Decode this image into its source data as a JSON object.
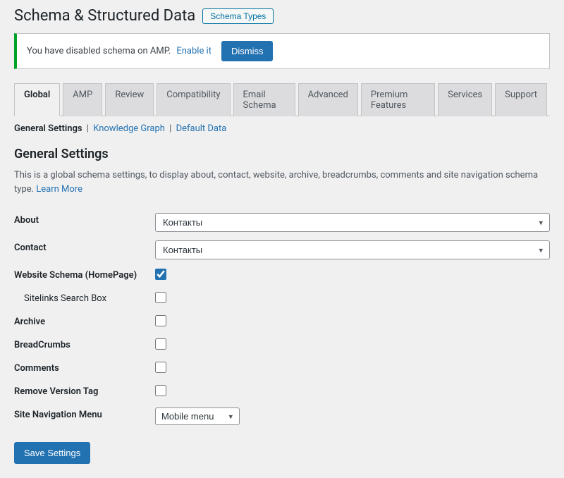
{
  "header": {
    "title": "Schema & Structured Data",
    "schema_types_btn": "Schema Types"
  },
  "notice": {
    "text": "You have disabled schema on AMP.",
    "enable_link": "Enable it",
    "dismiss": "Dismiss"
  },
  "tabs": [
    {
      "label": "Global",
      "active": true
    },
    {
      "label": "AMP",
      "active": false
    },
    {
      "label": "Review",
      "active": false
    },
    {
      "label": "Compatibility",
      "active": false
    },
    {
      "label": "Email Schema",
      "active": false
    },
    {
      "label": "Advanced",
      "active": false
    },
    {
      "label": "Premium Features",
      "active": false
    },
    {
      "label": "Services",
      "active": false
    },
    {
      "label": "Support",
      "active": false
    }
  ],
  "subnav": {
    "current": "General Settings",
    "links": [
      "Knowledge Graph",
      "Default Data"
    ],
    "sep": "|"
  },
  "section": {
    "title": "General Settings",
    "desc": "This is a global schema settings, to display about, contact, website, archive, breadcrumbs, comments and site navigation schema type.",
    "learn_more": "Learn More"
  },
  "fields": {
    "about": {
      "label": "About",
      "value": "Контакты"
    },
    "contact": {
      "label": "Contact",
      "value": "Контакты"
    },
    "website_schema": {
      "label": "Website Schema (HomePage)",
      "checked": true
    },
    "sitelinks": {
      "label": "Sitelinks Search Box",
      "checked": false
    },
    "archive": {
      "label": "Archive",
      "checked": false
    },
    "breadcrumbs": {
      "label": "BreadCrumbs",
      "checked": false
    },
    "comments": {
      "label": "Comments",
      "checked": false
    },
    "remove_version": {
      "label": "Remove Version Tag",
      "checked": false
    },
    "site_nav": {
      "label": "Site Navigation Menu",
      "value": "Mobile menu"
    }
  },
  "save_btn": "Save Settings"
}
